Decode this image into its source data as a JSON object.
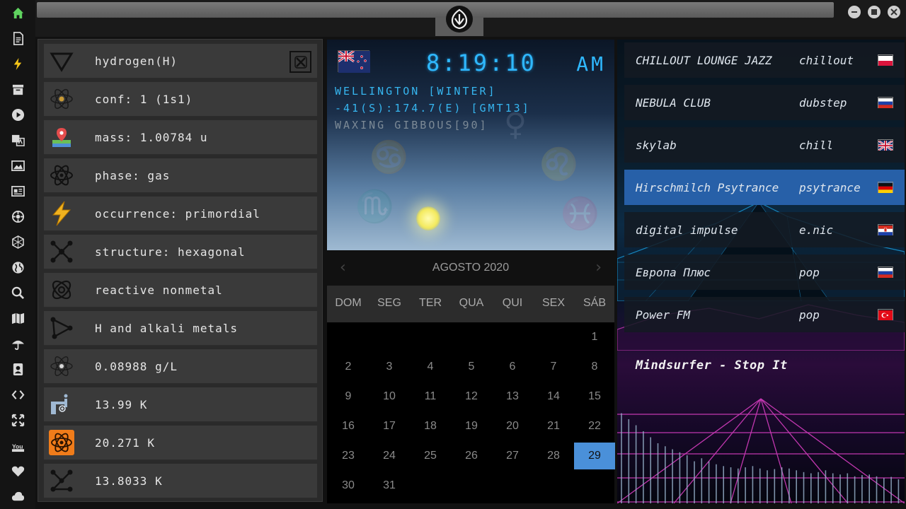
{
  "sidebar": {
    "items": [
      "home-icon",
      "document-icon",
      "lightning-icon",
      "archive-icon",
      "play-icon",
      "translate-icon",
      "image-icon",
      "news-icon",
      "settings-icon",
      "hexagon-icon",
      "globe-icon",
      "search-icon",
      "map-icon",
      "umbrella-icon",
      "contact-icon",
      "code-icon",
      "expand-icon",
      "youtube-icon",
      "heart-icon",
      "cloud-icon"
    ],
    "active_color": "#5fd35f"
  },
  "element": {
    "properties": [
      {
        "icon": "triangle-icon",
        "text": "hydrogen(H)"
      },
      {
        "icon": "atom-icon",
        "text": "conf: 1 (1s1)"
      },
      {
        "icon": "map-pin-icon",
        "text": "mass: 1.00784 u"
      },
      {
        "icon": "atom-outline-icon",
        "text": "phase: gas"
      },
      {
        "icon": "bolt-icon",
        "text": "occurrence: primordial"
      },
      {
        "icon": "molecule-icon",
        "text": "structure: hexagonal"
      },
      {
        "icon": "orbit-icon",
        "text": "reactive nonmetal"
      },
      {
        "icon": "graph-icon",
        "text": "H and alkali metals"
      },
      {
        "icon": "atom-small-icon",
        "text": "0.08988 g/L"
      },
      {
        "icon": "faucet-icon",
        "text": "13.99 K"
      },
      {
        "icon": "atom-orange-icon",
        "text": "20.271 K"
      },
      {
        "icon": "nodes-icon",
        "text": "13.8033 K"
      }
    ]
  },
  "clock": {
    "time": "8:19:10",
    "ampm": "AM",
    "city": "WELLINGTON [WINTER]",
    "coords": "-41(S):174.7(E) [GMT13]",
    "moon": "WAXING GIBBOUS[90]",
    "time_color": "#2fb8ff"
  },
  "calendar": {
    "month": "AGOSTO 2020",
    "prev_arrow": "‹",
    "next_arrow": "›",
    "weekdays": [
      "DOM",
      "SEG",
      "TER",
      "QUA",
      "QUI",
      "SEX",
      "SÁB"
    ],
    "weeks": [
      [
        "",
        "",
        "",
        "",
        "",
        "",
        "1"
      ],
      [
        "2",
        "3",
        "4",
        "5",
        "6",
        "7",
        "8"
      ],
      [
        "9",
        "10",
        "11",
        "12",
        "13",
        "14",
        "15"
      ],
      [
        "16",
        "17",
        "18",
        "19",
        "20",
        "21",
        "22"
      ],
      [
        "23",
        "24",
        "25",
        "26",
        "27",
        "28",
        "29"
      ],
      [
        "30",
        "31",
        "",
        "",
        "",
        "",
        ""
      ]
    ],
    "selected": "29",
    "selected_color": "#4a90d9"
  },
  "radio": {
    "stations": [
      {
        "name": "CHILLOUT LOUNGE JAZZ",
        "genre": "chillout",
        "flag": "pl"
      },
      {
        "name": "NEBULA CLUB",
        "genre": "dubstep",
        "flag": "ru"
      },
      {
        "name": "skylab",
        "genre": "chill",
        "flag": "gb"
      },
      {
        "name": "Hirschmilch Psytrance",
        "genre": "psytrance",
        "flag": "de"
      },
      {
        "name": "digital impulse",
        "genre": "e.nic",
        "flag": "hr"
      },
      {
        "name": "Европа Плюс",
        "genre": "pop",
        "flag": "ru"
      },
      {
        "name": "Power FM",
        "genre": "pop",
        "flag": "tr"
      }
    ],
    "active_index": 3,
    "now_playing": "Mindsurfer - Stop It"
  }
}
